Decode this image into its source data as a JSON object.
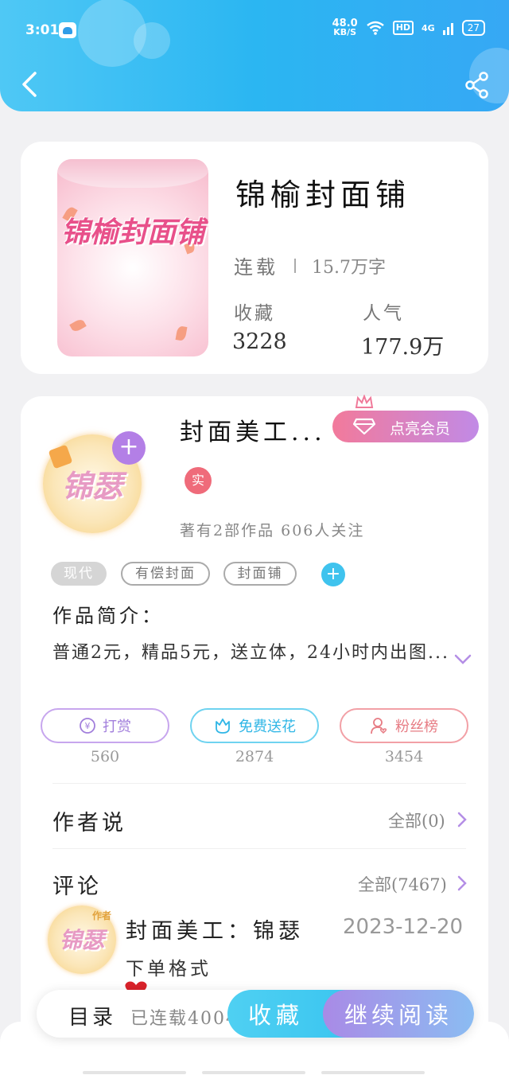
{
  "status_bar": {
    "time": "3:01",
    "net_speed": "48.0",
    "net_unit": "KB/S",
    "hd": "HD",
    "signal": "4G",
    "battery": "27"
  },
  "book": {
    "cover_title": "锦榆封面铺",
    "title": "锦榆封面铺",
    "status": "连载",
    "words": "15.7万字",
    "favorites_label": "收藏",
    "favorites_value": "3228",
    "popularity_label": "人气",
    "popularity_value": "177.9万"
  },
  "author": {
    "avatar_text": "锦瑟",
    "name": "封面美工...",
    "vip_button": "点亮会员",
    "real_badge": "实",
    "works_line": "著有2部作品 606人关注"
  },
  "tags": [
    "现代",
    "有偿封面",
    "封面铺"
  ],
  "intro": {
    "label": "作品简介：",
    "text": "普通2元，精品5元，送立体，24小时内出图..."
  },
  "actions": [
    {
      "label": "打赏",
      "count": "560",
      "color": "#b48ee6"
    },
    {
      "label": "免费送花",
      "count": "2874",
      "color": "#4cc6ee"
    },
    {
      "label": "粉丝榜",
      "count": "3454",
      "color": "#ef7f86"
    }
  ],
  "author_says": {
    "title": "作者说",
    "link": "全部(0)"
  },
  "comments": {
    "title": "评论",
    "link": "全部(7467)",
    "item": {
      "avatar_text": "锦瑟",
      "author_tag": "作者",
      "name": "封面美工：锦瑟",
      "date": "2023-12-20",
      "text": "下单格式"
    }
  },
  "bottom_bar": {
    "toc_label": "目录",
    "toc_status": "已连载4004",
    "favorite_button": "收藏",
    "read_button": "继续阅读"
  }
}
